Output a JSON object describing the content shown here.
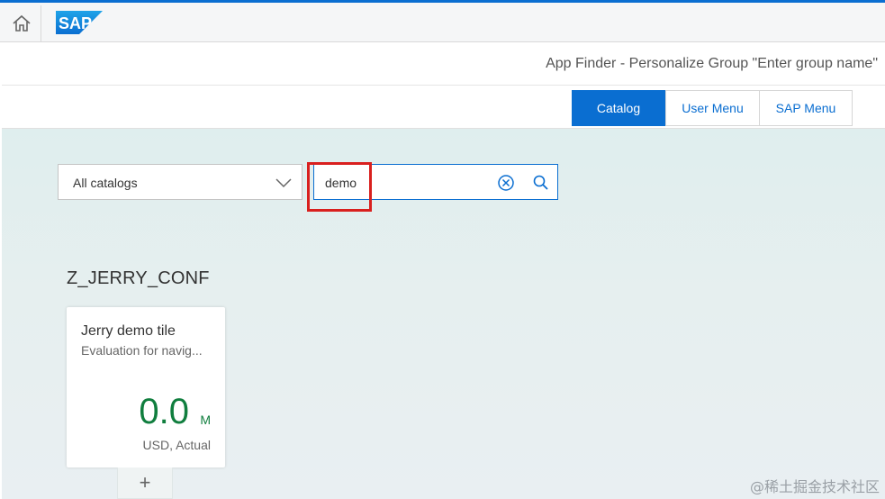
{
  "shell": {
    "home_icon": "home-icon",
    "logo_text": "SAP",
    "brand_color": "#0a6ed1"
  },
  "title_bar": {
    "title": "App Finder - Personalize Group \"Enter group name\""
  },
  "tabs": [
    {
      "label": "Catalog",
      "active": true
    },
    {
      "label": "User Menu",
      "active": false
    },
    {
      "label": "SAP Menu",
      "active": false
    }
  ],
  "filters": {
    "catalog_select": {
      "value": "All catalogs",
      "icon": "chevron-down-icon"
    },
    "search": {
      "value": "demo",
      "clear_icon": "clear-circle-icon",
      "search_icon": "search-icon"
    }
  },
  "group": {
    "title": "Z_JERRY_CONF"
  },
  "tile": {
    "title": "Jerry demo tile",
    "subtitle": "Evaluation for navig...",
    "value": "0.0",
    "unit": "M",
    "footer": "USD, Actual",
    "value_color": "#107e3e"
  },
  "add_button": {
    "label": "+"
  },
  "watermark": "@稀土掘金技术社区"
}
